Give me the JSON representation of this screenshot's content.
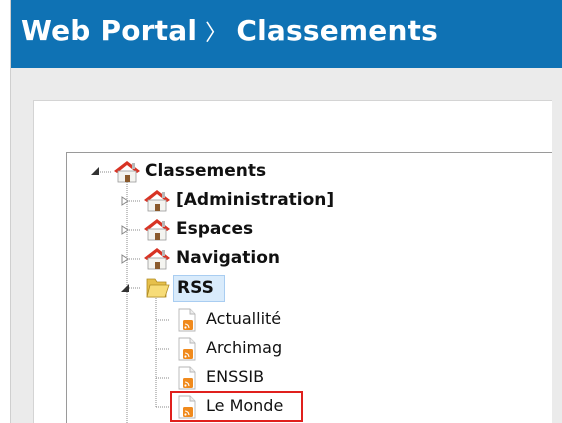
{
  "header": {
    "app_title": "Web Portal",
    "separator": "〉",
    "section_title": "Classements"
  },
  "tree": {
    "root": {
      "label": "Classements",
      "icon": "house-icon"
    },
    "children": [
      {
        "label": "[Administration]",
        "icon": "house-icon"
      },
      {
        "label": "Espaces",
        "icon": "house-icon"
      },
      {
        "label": "Navigation",
        "icon": "house-icon"
      },
      {
        "label": "RSS",
        "icon": "folder-icon",
        "expanded": true,
        "feeds": [
          {
            "label": "Actuallité",
            "icon": "rss-document-icon"
          },
          {
            "label": "Archimag",
            "icon": "rss-document-icon"
          },
          {
            "label": "ENSSIB",
            "icon": "rss-document-icon"
          },
          {
            "label": "Le Monde",
            "icon": "rss-document-icon",
            "selected": true
          }
        ]
      }
    ]
  },
  "colors": {
    "header_bg": "#0f72b4",
    "selection_border": "#e0201d",
    "highlight_bg": "#d9ebfb"
  }
}
